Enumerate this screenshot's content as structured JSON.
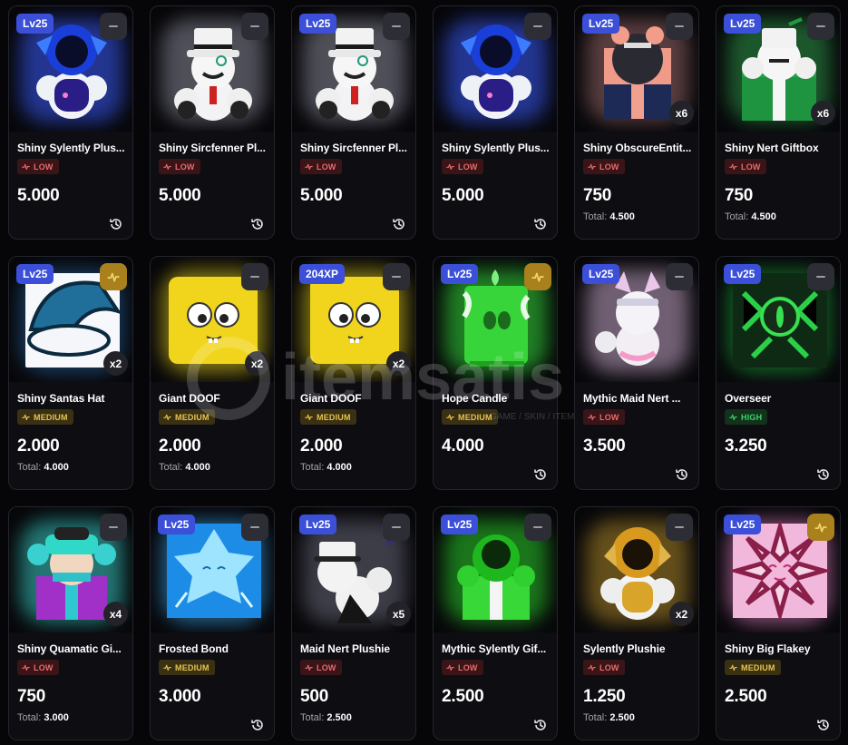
{
  "watermark": {
    "text": "itemsatis",
    "sub": "GAME / SKIN / ITEM"
  },
  "labels": {
    "total_prefix": "Total:"
  },
  "colors": {
    "lv_badge": "#3b4fd8",
    "low": "#e66b6f",
    "medium": "#e7c34c",
    "high": "#3ed26b",
    "gold_corner": "#a8801c"
  },
  "items": [
    {
      "name": "Shiny Sylently Plus...",
      "tag": "Lv25",
      "corner": "minus-icon",
      "qty": "",
      "demand": "LOW",
      "price": "5.000",
      "total": "",
      "history": true,
      "art": "blue-robot-plushie",
      "glow": "#3b5cff"
    },
    {
      "name": "Shiny Sircfenner Pl...",
      "tag": "",
      "corner": "minus-icon",
      "qty": "",
      "demand": "LOW",
      "price": "5.000",
      "total": "",
      "history": true,
      "art": "white-tophat-plushie",
      "glow": "#8a8a9a"
    },
    {
      "name": "Shiny Sircfenner Pl...",
      "tag": "Lv25",
      "corner": "minus-icon",
      "qty": "",
      "demand": "LOW",
      "price": "5.000",
      "total": "",
      "history": true,
      "art": "white-tophat-plushie",
      "glow": "#8a8a9a"
    },
    {
      "name": "Shiny Sylently Plus...",
      "tag": "",
      "corner": "minus-icon",
      "qty": "",
      "demand": "LOW",
      "price": "5.000",
      "total": "",
      "history": true,
      "art": "blue-robot-plushie",
      "glow": "#3b5cff"
    },
    {
      "name": "Shiny ObscureEntit...",
      "tag": "Lv25",
      "corner": "minus-icon",
      "qty": "x6",
      "demand": "LOW",
      "price": "750",
      "total": "4.500",
      "history": false,
      "art": "dark-giftbox",
      "glow": "#9a6a6a"
    },
    {
      "name": "Shiny Nert Giftbox",
      "tag": "Lv25",
      "corner": "minus-icon",
      "qty": "x6",
      "demand": "LOW",
      "price": "750",
      "total": "4.500",
      "history": false,
      "art": "green-giftbox",
      "glow": "#2f9a4a"
    },
    {
      "name": "Shiny Santas Hat",
      "tag": "Lv25",
      "corner": "pulse-icon",
      "qty": "x2",
      "demand": "MEDIUM",
      "price": "2.000",
      "total": "4.000",
      "history": false,
      "art": "blue-santa-hat",
      "glow": "#2a6aa8"
    },
    {
      "name": "Giant DOOF",
      "tag": "",
      "corner": "minus-icon",
      "qty": "x2",
      "demand": "MEDIUM",
      "price": "2.000",
      "total": "4.000",
      "history": false,
      "art": "yellow-block",
      "glow": "#e8d21a"
    },
    {
      "name": "Giant DOOF",
      "tag": "204XP",
      "corner": "minus-icon",
      "qty": "x2",
      "demand": "MEDIUM",
      "price": "2.000",
      "total": "4.000",
      "history": false,
      "art": "yellow-block",
      "glow": "#e8d21a"
    },
    {
      "name": "Hope Candle",
      "tag": "Lv25",
      "corner": "pulse-icon",
      "qty": "",
      "demand": "MEDIUM",
      "price": "4.000",
      "total": "",
      "history": true,
      "art": "green-candle",
      "glow": "#35e03a"
    },
    {
      "name": "Mythic Maid Nert ...",
      "tag": "Lv25",
      "corner": "minus-icon",
      "qty": "",
      "demand": "LOW",
      "price": "3.500",
      "total": "",
      "history": true,
      "art": "maid-cat-plushie",
      "glow": "#c7a8c9"
    },
    {
      "name": "Overseer",
      "tag": "Lv25",
      "corner": "minus-icon",
      "qty": "",
      "demand": "HIGH",
      "price": "3.250",
      "total": "",
      "history": true,
      "art": "green-eye-monster",
      "glow": "#1ea83a"
    },
    {
      "name": "Shiny Quamatic Gi...",
      "tag": "",
      "corner": "minus-icon",
      "qty": "x4",
      "demand": "LOW",
      "price": "750",
      "total": "3.000",
      "history": false,
      "art": "cyan-giftbox",
      "glow": "#3ad0c8"
    },
    {
      "name": "Frosted Bond",
      "tag": "Lv25",
      "corner": "minus-icon",
      "qty": "",
      "demand": "MEDIUM",
      "price": "3.000",
      "total": "",
      "history": true,
      "art": "ice-crystal",
      "glow": "#3aa8f0"
    },
    {
      "name": "Maid Nert Plushie",
      "tag": "Lv25",
      "corner": "minus-icon",
      "qty": "x5",
      "demand": "LOW",
      "price": "500",
      "total": "2.500",
      "history": false,
      "art": "maid-plushie",
      "glow": "#6a6a7a"
    },
    {
      "name": "Mythic Sylently Gif...",
      "tag": "Lv25",
      "corner": "minus-icon",
      "qty": "",
      "demand": "LOW",
      "price": "2.500",
      "total": "",
      "history": true,
      "art": "green-robot-gift",
      "glow": "#2ad02a"
    },
    {
      "name": "Sylently Plushie",
      "tag": "",
      "corner": "minus-icon",
      "qty": "x2",
      "demand": "LOW",
      "price": "1.250",
      "total": "2.500",
      "history": false,
      "art": "gold-robot-plushie",
      "glow": "#b08a2a"
    },
    {
      "name": "Shiny Big Flakey",
      "tag": "Lv25",
      "corner": "pulse-icon",
      "qty": "",
      "demand": "MEDIUM",
      "price": "2.500",
      "total": "",
      "history": true,
      "art": "pink-snowflake",
      "glow": "#f08ad0"
    }
  ]
}
